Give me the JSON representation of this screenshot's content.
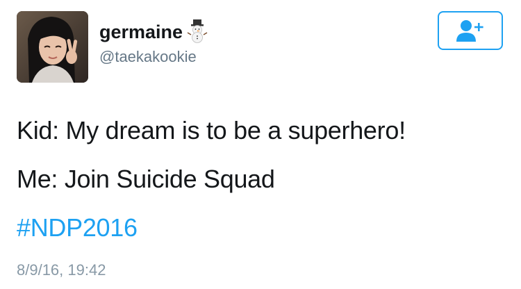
{
  "user": {
    "display_name": "germaine",
    "handle": "@taekakookie",
    "name_emoji_icon": "snowman-icon",
    "avatar": "profile-photo"
  },
  "follow_button": {
    "icon": "add-user-icon"
  },
  "tweet": {
    "lines": [
      "Kid: My dream is to be a superhero!",
      "Me: Join Suicide Squad"
    ],
    "hashtag": "#NDP2016",
    "timestamp": "8/9/16, 19:42"
  },
  "colors": {
    "accent": "#1da1f2",
    "text": "#14171a",
    "secondary": "#657786",
    "timestamp": "#8899a6"
  }
}
